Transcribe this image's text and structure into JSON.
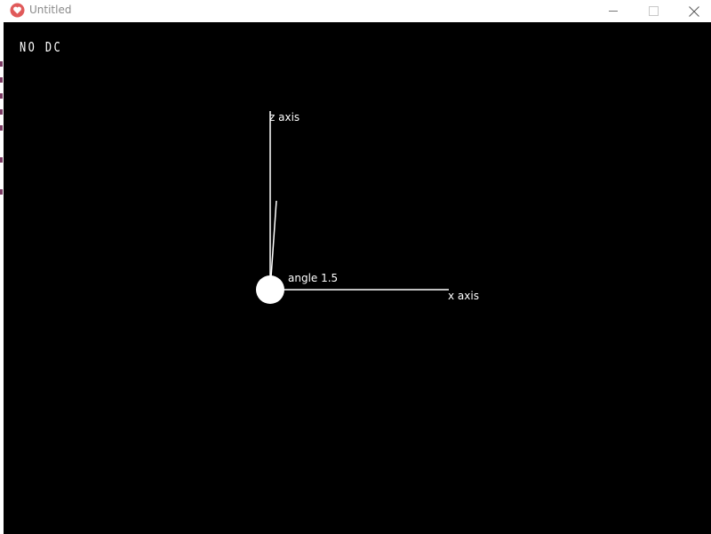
{
  "window": {
    "title": "Untitled",
    "controls": {
      "minimize": "minimize-icon",
      "maximize": "maximize-icon",
      "close": "close-icon"
    },
    "app_icon": "heart-app-icon"
  },
  "colors": {
    "canvas_bg": "#000000",
    "foreground": "#ffffff",
    "titlebar_bg": "#ffffff",
    "app_icon_accent": "#e05a5a"
  },
  "scene": {
    "hud_text": "NO DC",
    "z_axis_label": "z axis",
    "x_axis_label": "x axis",
    "angle_label": "angle 1.5"
  }
}
